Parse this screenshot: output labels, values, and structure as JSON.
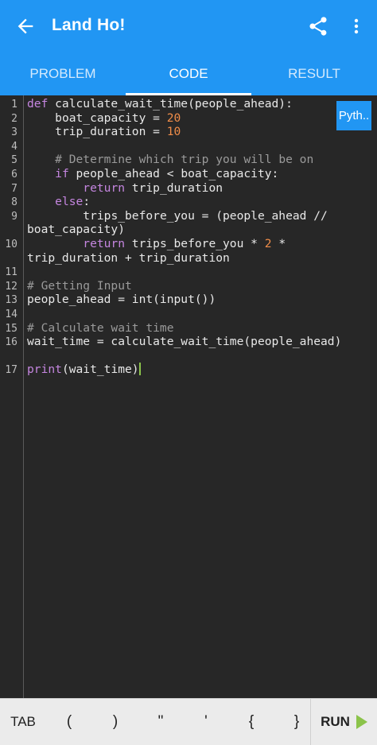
{
  "appbar": {
    "title": "Land Ho!",
    "back_icon": "arrow-back-icon",
    "share_icon": "share-icon",
    "more_icon": "more-vertical-icon",
    "color": "#2196f3"
  },
  "tabs": [
    {
      "label": "PROBLEM",
      "active": false
    },
    {
      "label": "CODE",
      "active": true
    },
    {
      "label": "RESULT",
      "active": false
    }
  ],
  "editor": {
    "language_badge": "Pyth..",
    "line_numbers": [
      "1",
      "2",
      "3",
      "4",
      "5",
      "6",
      "7",
      "8",
      "9",
      "10",
      "11",
      "12",
      "13",
      "14",
      "15",
      "16",
      "17"
    ],
    "lines": [
      "def calculate_wait_time(people_ahead):",
      "    boat_capacity = 20",
      "    trip_duration = 10",
      "",
      "    # Determine which trip you will be on",
      "    if people_ahead < boat_capacity:",
      "        return trip_duration",
      "    else:",
      "        trips_before_you = (people_ahead // boat_capacity)",
      "        return trips_before_you * 2 * trip_duration + trip_duration",
      "",
      "# Getting Input",
      "people_ahead = int(input())",
      "",
      "# Calculate wait time",
      "wait_time = calculate_wait_time(people_ahead)",
      "print(wait_time)"
    ]
  },
  "bottom_bar": {
    "keys": [
      "TAB",
      "(",
      ")",
      "\"",
      "'",
      "{",
      "}"
    ],
    "run_label": "RUN",
    "run_icon": "play-icon",
    "run_icon_color": "#8bc34a"
  }
}
